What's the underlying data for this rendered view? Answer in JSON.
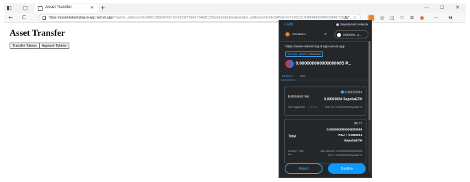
{
  "browser": {
    "tab_title": "Asset Transfer",
    "tab_close": "×",
    "new_tab": "+",
    "url_main": "https://asset-tokenizing-d-app.vercel.app",
    "url_rest": "/?owner_address=0x49f07380047457CF9539f75864774fdfC305a6b29&other&sender_address=0x0bc94f59e7e71455257b48348d9df8539bf4725052...",
    "icons": {
      "back": "←",
      "reload": "C",
      "read_aloud": "A⁺",
      "favorite": "☆",
      "extensions": "◎",
      "split": "◫",
      "favorites_bar": "✩",
      "collections": "⧉",
      "profile": "●",
      "more": "···",
      "sidebar": "▮▮"
    },
    "window_controls": [
      "—",
      "☐",
      "✕"
    ]
  },
  "page": {
    "title": "Asset Transfer",
    "buttons": [
      "Transfer Tokens",
      "Approve Tokens"
    ]
  },
  "metamask": {
    "edit": "< Edit",
    "network": "Sepolia test network",
    "account_from": "Account 1",
    "arrow": "→",
    "account_to": "0x38c94...2...",
    "origin": "https://asset-tokenizing-d-app.vercel.app",
    "contract_chip": "0xeCdf9...a0607",
    "contract_chip_sub": "/ Interaction",
    "value": "0.000000000000000005 P...",
    "tabs": [
      "DETAILS",
      "HEX"
    ],
    "fee": {
      "label": "Estimated fee",
      "fiat": "0.00020054",
      "eth": "0.00020054 SepoliaETH",
      "likely": "Site suggested",
      "time": "< 30 sec",
      "max_fee": "Max fee: 0.00020096 SepoliaETH"
    },
    "total": {
      "label": "Total",
      "fiat": "$0.77",
      "amount_line1": "0.000000000000000005",
      "amount_line2": "P&J + 0.000201",
      "amount_line3": "SepoliaETH",
      "sub_label": "Amount + gas fee",
      "max_amount": "Max amount: 0.000000000000000005",
      "max_amount2": "P&J + 0.00020096 SepoliaETH"
    },
    "reject_label": "Reject",
    "confirm_label": "Confirm"
  }
}
